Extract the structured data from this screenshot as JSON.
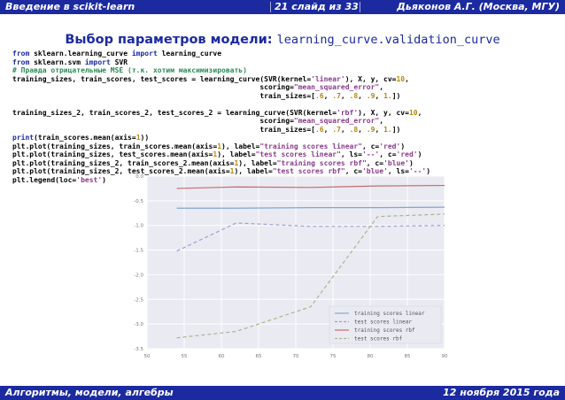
{
  "header": {
    "left": "Введение в scikit-learn",
    "center": "21 слайд из 33",
    "right": "Дьяконов А.Г. (Москва, МГУ)"
  },
  "footer": {
    "left": "Алгоритмы, модели, алгебры",
    "right": "12 ноября 2015 года"
  },
  "slide": {
    "title_text": "Выбор параметров модели: ",
    "title_code": "learning_curve.validation_curve"
  },
  "code_lines": [
    [
      [
        "from",
        "kw"
      ],
      [
        " sklearn.learning_curve ",
        ""
      ],
      [
        "import",
        "kw"
      ],
      [
        " learning_curve",
        ""
      ]
    ],
    [
      [
        "from",
        "kw"
      ],
      [
        " sklearn.svm ",
        ""
      ],
      [
        "import",
        "kw"
      ],
      [
        " SVR",
        ""
      ]
    ],
    [
      [
        "# Правда отрицательные MSE (т.к. хотим максимизировать)",
        "cm"
      ]
    ],
    [
      [
        "training_sizes, train_scores, test_scores = learning_curve(SVR(kernel=",
        ""
      ],
      [
        "'linear'",
        "str"
      ],
      [
        "), X, y, cv=",
        ""
      ],
      [
        "10",
        "num"
      ],
      [
        ",",
        ""
      ]
    ],
    [
      [
        "                                                          scoring=",
        ""
      ],
      [
        "\"mean_squared_error\"",
        "str"
      ],
      [
        ",",
        ""
      ]
    ],
    [
      [
        "                                                          train_sizes=[",
        ""
      ],
      [
        ".6",
        "num"
      ],
      [
        ", ",
        ""
      ],
      [
        ".7",
        "num"
      ],
      [
        ", ",
        ""
      ],
      [
        ".8",
        "num"
      ],
      [
        ", ",
        ""
      ],
      [
        ".9",
        "num"
      ],
      [
        ", ",
        ""
      ],
      [
        "1.",
        "num"
      ],
      [
        "])",
        ""
      ]
    ],
    [
      [
        "",
        ""
      ]
    ],
    [
      [
        "training_sizes_2, train_scores_2, test_scores_2 = learning_curve(SVR(kernel=",
        ""
      ],
      [
        "'rbf'",
        "str"
      ],
      [
        "), X, y, cv=",
        ""
      ],
      [
        "10",
        "num"
      ],
      [
        ",",
        ""
      ]
    ],
    [
      [
        "                                                          scoring=",
        ""
      ],
      [
        "\"mean_squared_error\"",
        "str"
      ],
      [
        ",",
        ""
      ]
    ],
    [
      [
        "                                                          train_sizes=[",
        ""
      ],
      [
        ".6",
        "num"
      ],
      [
        ", ",
        ""
      ],
      [
        ".7",
        "num"
      ],
      [
        ", ",
        ""
      ],
      [
        ".8",
        "num"
      ],
      [
        ", ",
        ""
      ],
      [
        ".9",
        "num"
      ],
      [
        ", ",
        ""
      ],
      [
        "1.",
        "num"
      ],
      [
        "])",
        ""
      ]
    ],
    [
      [
        "print",
        "bi"
      ],
      [
        "(train_scores.mean(axis=",
        ""
      ],
      [
        "1",
        "num"
      ],
      [
        "))",
        ""
      ]
    ],
    [
      [
        "plt.plot(training_sizes, train_scores.mean(axis=",
        ""
      ],
      [
        "1",
        "num"
      ],
      [
        "), label=",
        ""
      ],
      [
        "\"training scores linear\"",
        "str"
      ],
      [
        ", c=",
        ""
      ],
      [
        "'red'",
        "str"
      ],
      [
        ")",
        ""
      ]
    ],
    [
      [
        "plt.plot(training_sizes, test_scores.mean(axis=",
        ""
      ],
      [
        "1",
        "num"
      ],
      [
        "), label=",
        ""
      ],
      [
        "\"test scores linear\"",
        "str"
      ],
      [
        ", ls=",
        ""
      ],
      [
        "'--'",
        "str"
      ],
      [
        ", c=",
        ""
      ],
      [
        "'red'",
        "str"
      ],
      [
        ")",
        ""
      ]
    ],
    [
      [
        "plt.plot(training_sizes_2, train_scores_2.mean(axis=",
        ""
      ],
      [
        "1",
        "num"
      ],
      [
        "), label=",
        ""
      ],
      [
        "\"training scores rbf\"",
        "str"
      ],
      [
        ", c=",
        ""
      ],
      [
        "'blue'",
        "str"
      ],
      [
        ")",
        ""
      ]
    ],
    [
      [
        "plt.plot(training_sizes_2, test_scores_2.mean(axis=",
        ""
      ],
      [
        "1",
        "num"
      ],
      [
        "), label=",
        ""
      ],
      [
        "\"test scores rbf\"",
        "str"
      ],
      [
        ", c=",
        ""
      ],
      [
        "'blue'",
        "str"
      ],
      [
        ", ls=",
        ""
      ],
      [
        "'--'",
        "str"
      ],
      [
        ")",
        ""
      ]
    ],
    [
      [
        "plt.legend(loc=",
        ""
      ],
      [
        "'best'",
        "str"
      ],
      [
        ")",
        ""
      ]
    ]
  ],
  "chart_data": {
    "type": "line",
    "xlim": [
      50,
      90
    ],
    "ylim": [
      -3.5,
      0.0
    ],
    "xticks": [
      "50",
      "55",
      "60",
      "65",
      "70",
      "75",
      "80",
      "85",
      "90"
    ],
    "yticks": [
      "0.0",
      "-0.5",
      "-1.0",
      "-1.5",
      "-2.0",
      "-2.5",
      "-3.0",
      "-3.5"
    ],
    "grid": true,
    "legend_position": "lower-right",
    "series": [
      {
        "name": "training scores linear",
        "color": "#7fa8d0",
        "dash": false,
        "x": [
          54,
          62,
          72,
          81,
          90
        ],
        "y": [
          -0.65,
          -0.65,
          -0.64,
          -0.64,
          -0.63
        ]
      },
      {
        "name": "test scores linear",
        "color": "#9e9ed4",
        "dash": true,
        "x": [
          54,
          62,
          72,
          81,
          90
        ],
        "y": [
          -1.52,
          -0.95,
          -1.02,
          -1.02,
          -1.0
        ]
      },
      {
        "name": "training scores rbf",
        "color": "#c96a6a",
        "dash": false,
        "x": [
          54,
          62,
          72,
          81,
          90
        ],
        "y": [
          -0.25,
          -0.22,
          -0.23,
          -0.2,
          -0.19
        ]
      },
      {
        "name": "test scores rbf",
        "color": "#a8b78a",
        "dash": true,
        "x": [
          54,
          62,
          72,
          81,
          90
        ],
        "y": [
          -3.28,
          -3.15,
          -2.65,
          -0.82,
          -0.77
        ]
      }
    ]
  }
}
